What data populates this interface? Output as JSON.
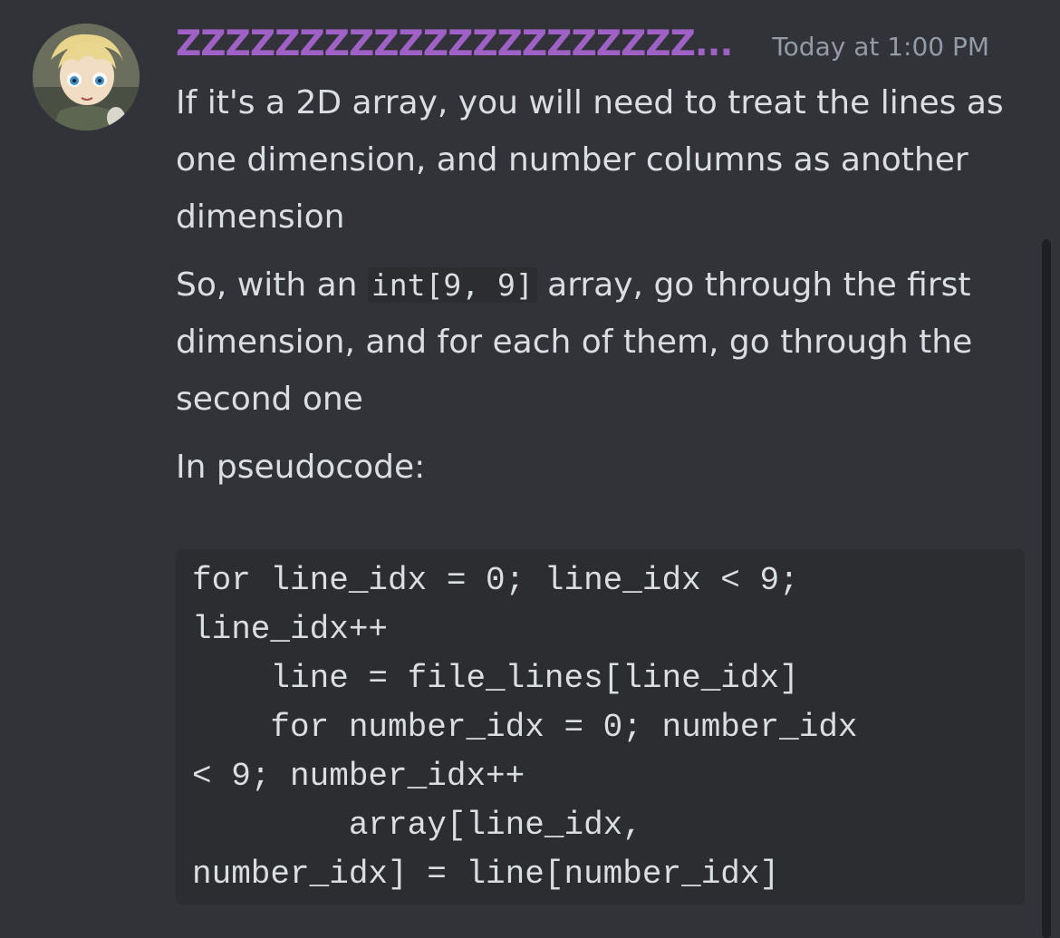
{
  "message": {
    "author": "ZZZZZZZZZZZZZZZZZZZZZ...",
    "timestamp": "Today at 1:00 PM",
    "paragraph1": "If it's a 2D array, you will need to treat the lines as one dimension, and number columns as another dimension",
    "paragraph2_before": "So, with an ",
    "paragraph2_code": "int[9, 9]",
    "paragraph2_after": " array, go through the first dimension, and for each of them, go through the second one",
    "paragraph3": "In pseudocode:",
    "code_lines": [
      "for line_idx = 0; line_idx < 9;",
      "line_idx++",
      "    line = file_lines[line_idx]",
      "    for number_idx = 0; number_idx",
      "< 9; number_idx++",
      "        array[line_idx,",
      "number_idx] = line[number_idx]"
    ]
  },
  "colors": {
    "background": "#313338",
    "username": "#a061c7",
    "timestamp": "#949ba4",
    "text": "#dbdee1",
    "code_background": "#2b2d31"
  }
}
